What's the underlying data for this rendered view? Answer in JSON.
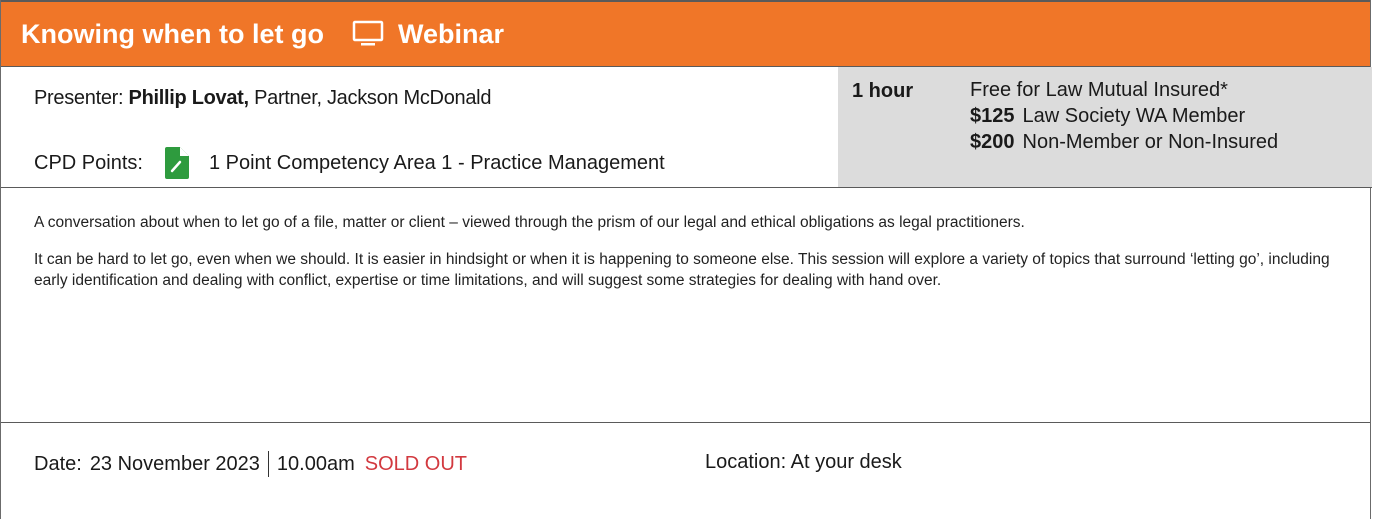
{
  "header": {
    "title": "Knowing when to let go",
    "type_label": "Webinar",
    "type_icon": "monitor-icon",
    "background": "#f07628"
  },
  "presenter": {
    "label": "Presenter:",
    "name": "Phillip Lovat,",
    "details": "Partner, Jackson McDonald"
  },
  "cpd": {
    "label": "CPD Points:",
    "icon": "document-icon",
    "icon_color": "#2e9b3e",
    "value": "1 Point Competency Area 1 - Practice Management"
  },
  "pricing": {
    "duration": "1 hour",
    "free_text": "Free for Law Mutual Insured*",
    "tiers": [
      {
        "price": "$125",
        "label": "Law Society WA Member"
      },
      {
        "price": "$200",
        "label": "Non-Member or Non-Insured"
      }
    ]
  },
  "description": {
    "paragraphs": [
      "A conversation about when to let go of a file, matter or client – viewed through the prism of our legal and ethical obligations as legal practitioners.",
      "It can be hard to let go, even when we should. It is easier in hindsight or when it is happening to someone else. This session will explore a variety of topics that surround ‘letting go’, including early identification and dealing with conflict, expertise or time limitations, and will suggest some strategies for dealing with hand over."
    ]
  },
  "event": {
    "date_label": "Date:",
    "date": "23 November 2023",
    "time": "10.00am",
    "status": "SOLD OUT",
    "status_color": "#d2393f",
    "location_label": "Location:",
    "location": "At your desk"
  }
}
